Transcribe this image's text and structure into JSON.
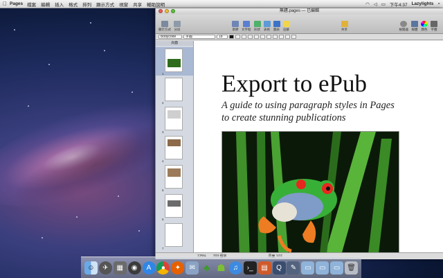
{
  "menubar": {
    "apple": "",
    "app_name": "Pages",
    "items": [
      "檔案",
      "編輯",
      "插入",
      "格式",
      "排列",
      "顯示方式",
      "視窗",
      "共享",
      "輔助說明"
    ],
    "time": "下午4:37",
    "user": "Lazylights"
  },
  "window": {
    "title": "無題.pages — 已編輯",
    "toolbar_left": [
      "顯示方式",
      "分段"
    ],
    "toolbar_mid": [
      "章節",
      "文字框",
      "形狀",
      "表格",
      "圖表",
      "註解"
    ],
    "toolbar_mid2": [
      "共享"
    ],
    "toolbar_right": [
      "檢閱器",
      "媒體",
      "顏色",
      "字體"
    ],
    "format": {
      "style": "Bodycode",
      "font": "字體",
      "size": "18"
    },
    "sidebar_header": "頁面",
    "pages": [
      "1",
      "2",
      "3",
      "4",
      "5",
      "6",
      "7"
    ]
  },
  "document": {
    "title": "Export to ePub",
    "subtitle_line1": "A guide to using paragraph styles in Pages",
    "subtitle_line2": "to create stunning publications"
  },
  "statusbar": {
    "zoom": "125%",
    "words": "703 個字",
    "page": "頁面 1/11"
  },
  "dock": [
    "finder-icon",
    "launchpad-icon",
    "mission-control-icon",
    "dashboard-icon",
    "app-store-icon",
    "chrome-icon",
    "firefox-icon",
    "mail-icon",
    "tree-icon",
    "android-icon",
    "itunes-icon",
    "terminal-icon",
    "presentation-icon",
    "quicktime-icon",
    "pen-icon",
    "folder-icon",
    "folder-icon",
    "folder-icon",
    "trash-icon"
  ]
}
